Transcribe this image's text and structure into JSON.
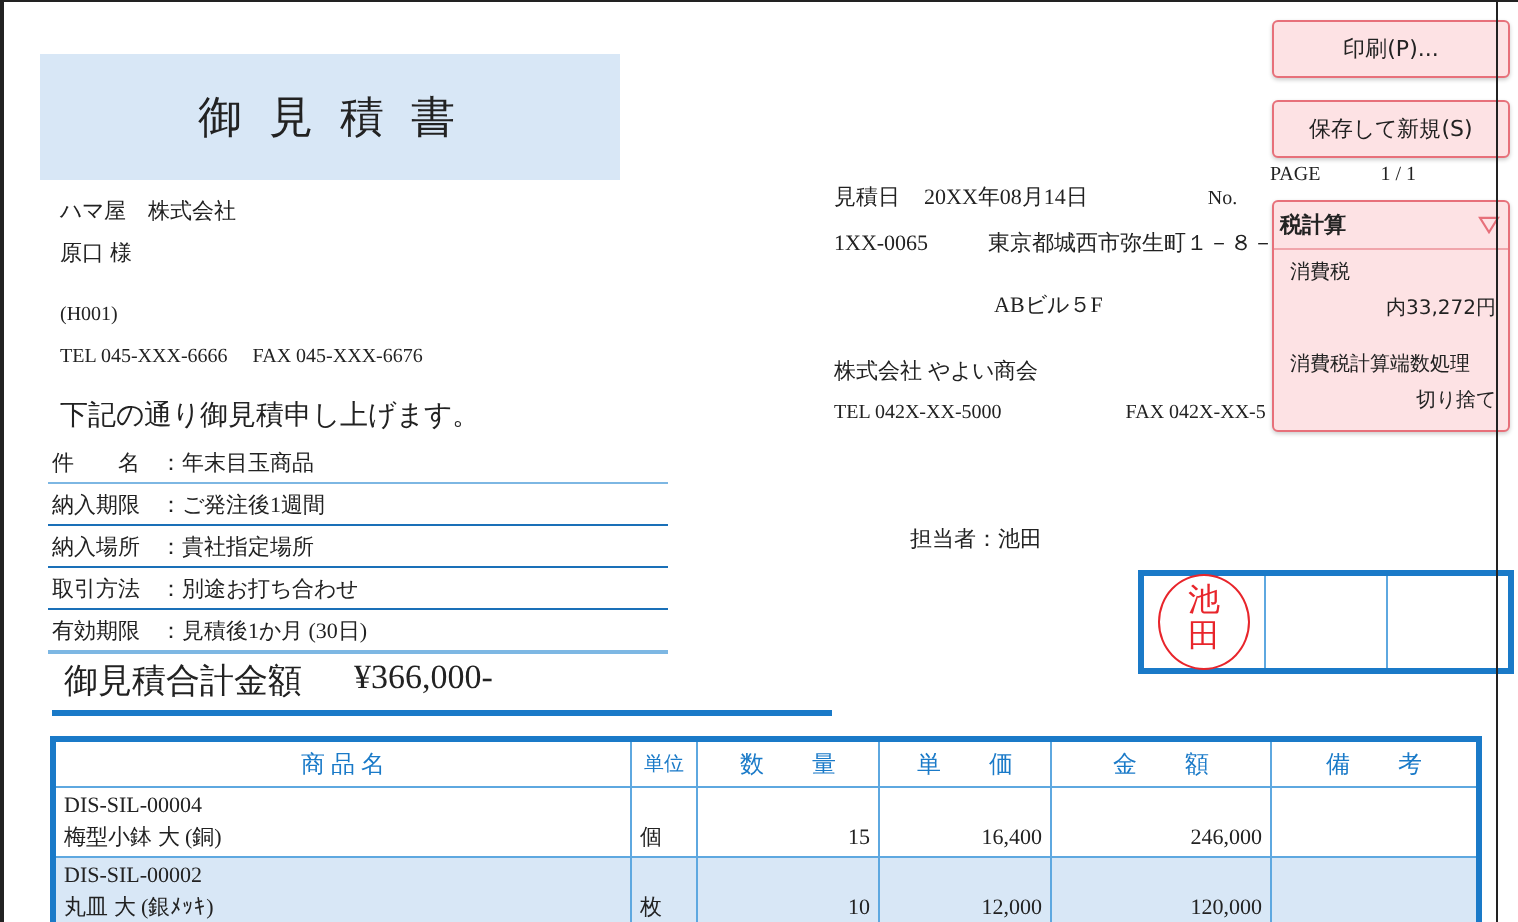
{
  "document": {
    "title": "御 見 積 書",
    "customer": {
      "company": "ハマ屋　株式会社",
      "contact": "原口 様",
      "code": "(H001)",
      "phone": "TEL 045-XXX-6666　 FAX 045-XXX-6676"
    },
    "greeting": "下記の通り御見積申し上げます。",
    "terms": [
      {
        "label": "件　　名",
        "value": "：年末目玉商品"
      },
      {
        "label": "納入期限",
        "value": "：ご発注後1週間"
      },
      {
        "label": "納入場所",
        "value": "：貴社指定場所"
      },
      {
        "label": "取引方法",
        "value": "：別途お打ち合わせ"
      },
      {
        "label": "有効期限",
        "value": "：見積後1か月 (30日)"
      }
    ],
    "total_label": "御見積合計金額",
    "total_value": "¥366,000-",
    "page_label": "PAGE",
    "page_value": "1 / 1",
    "date_label": "見積日",
    "date_value": "20XX年08月14日",
    "no_label": "No.",
    "postal_code": "1XX-0065",
    "address": "東京都城西市弥生町１－８－",
    "building": "ABビル５F",
    "issuer": "株式会社 やよい商会",
    "issuer_phone": "TEL 042X-XX-5000",
    "issuer_fax": "FAX 042X-XX-5",
    "person": "担当者：池田",
    "stamps": [
      {
        "kind": "seal",
        "text": "池田"
      },
      {
        "kind": "empty"
      },
      {
        "kind": "empty"
      }
    ],
    "table": {
      "columns": [
        "商 品 名",
        "単位",
        "数　　量",
        "単　　価",
        "金　　額",
        "備　　考"
      ],
      "rows": [
        {
          "code": "DIS-SIL-00004",
          "name": "梅型小鉢 大 (銅)",
          "unit": "個",
          "quantity": "15",
          "price": "16,400",
          "amount": "246,000",
          "selected": false
        },
        {
          "code": "DIS-SIL-00002",
          "name": "丸皿 大 (銀ﾒｯｷ)",
          "unit": "枚",
          "quantity": "10",
          "price": "12,000",
          "amount": "120,000",
          "selected": true
        }
      ]
    }
  },
  "buttons": [
    "印刷(P)...",
    "保存して新規(S)"
  ],
  "tax_panel": {
    "title": "税計算",
    "expanded": true,
    "tax_label": "消費税",
    "tax_value": "内33,272円",
    "rounding_label": "消費税計算端数処理",
    "rounding_value": "切り捨て"
  }
}
